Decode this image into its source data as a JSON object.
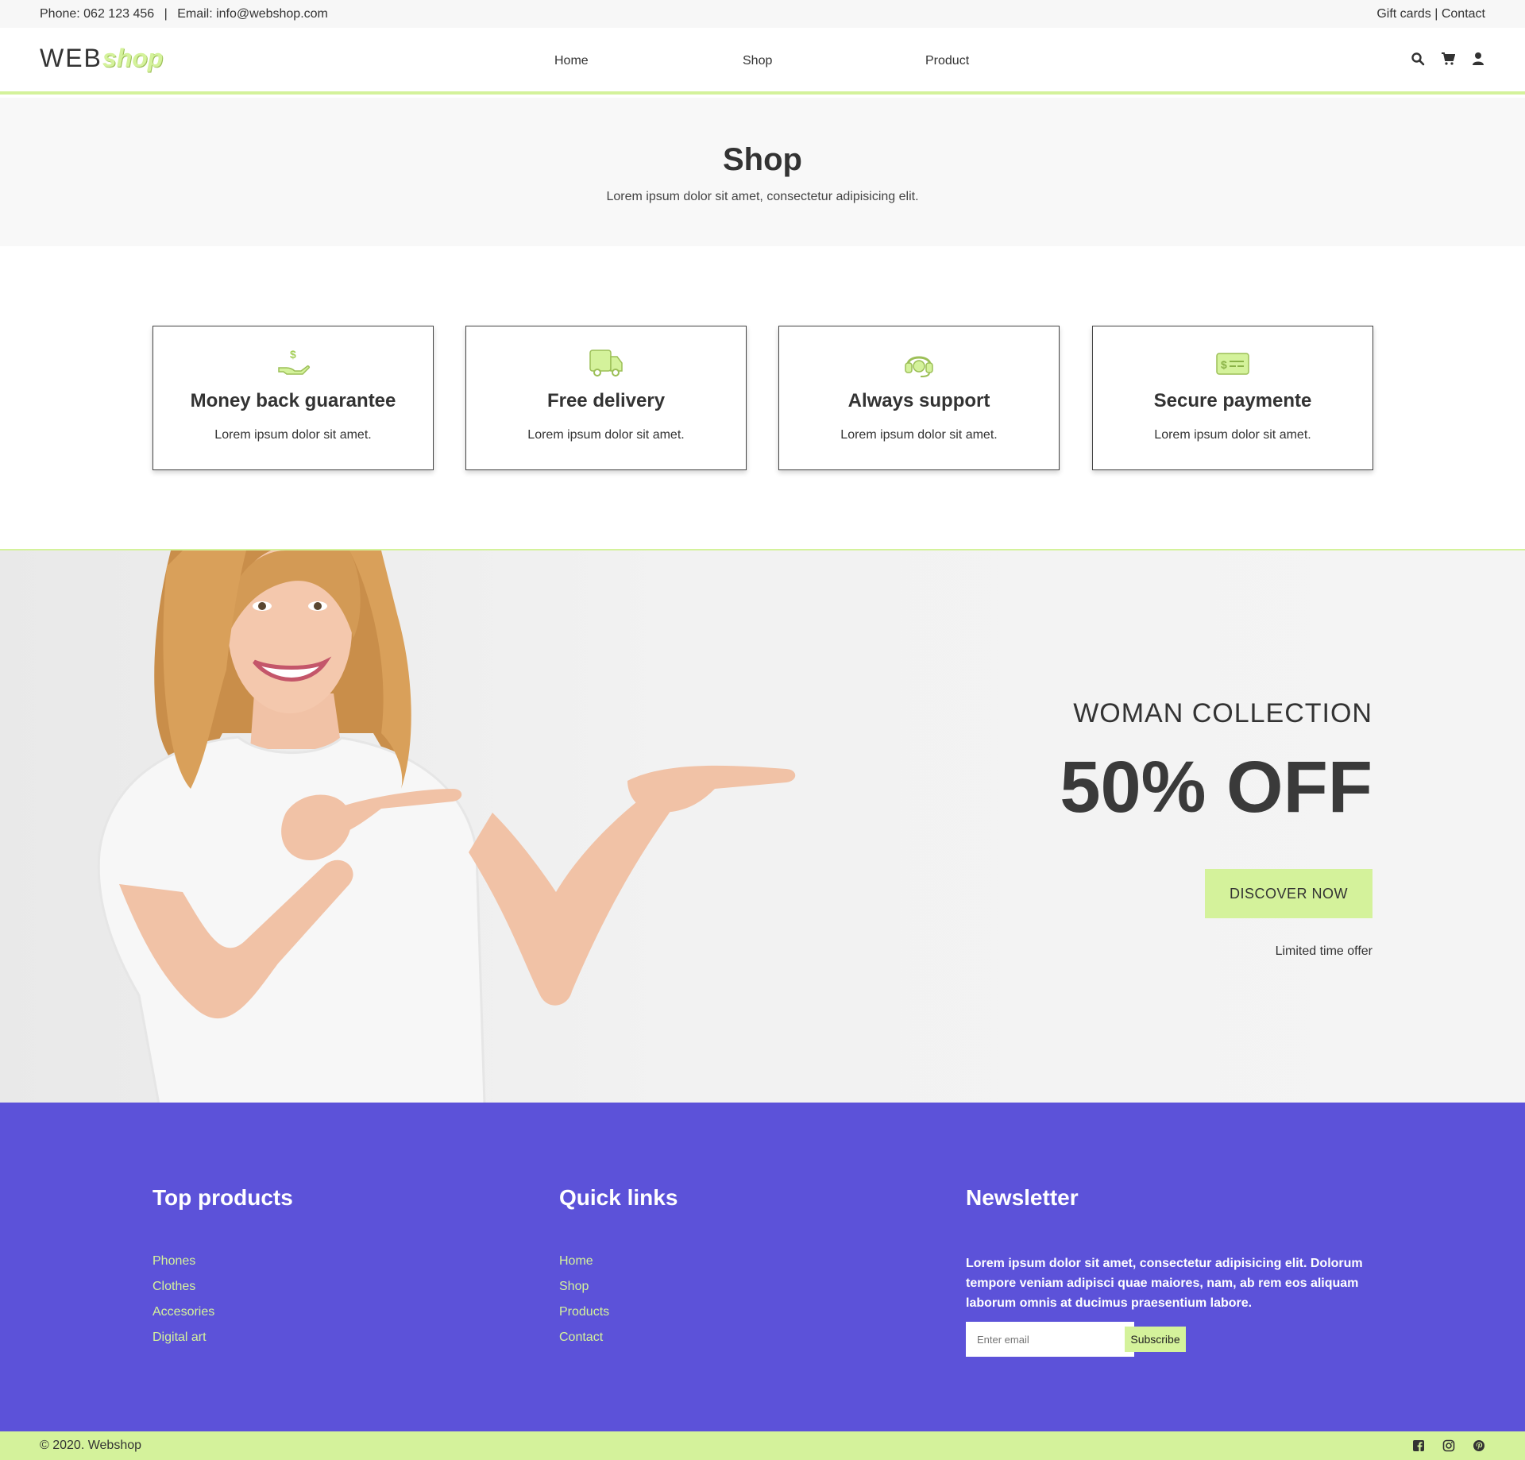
{
  "topbar": {
    "phone": "Phone: 062 123 456",
    "separator": "|",
    "email": "Email: info@webshop.com",
    "right_links": "Gift cards | Contact"
  },
  "header": {
    "logo_web": "WEB",
    "logo_shop": "shop",
    "nav": {
      "home": "Home",
      "shop": "Shop",
      "product": "Product"
    },
    "icons": [
      "search-icon",
      "cart-icon",
      "user-icon"
    ]
  },
  "page": {
    "title": "Shop",
    "subtitle": "Lorem ipsum dolor sit amet, consectetur adipisicing elit."
  },
  "features": [
    {
      "icon": "money-hand-icon",
      "title": "Money back guarantee",
      "text": "Lorem ipsum dolor sit amet."
    },
    {
      "icon": "truck-icon",
      "title": "Free delivery",
      "text": "Lorem ipsum dolor sit amet."
    },
    {
      "icon": "headset-icon",
      "title": "Always support",
      "text": "Lorem ipsum dolor sit amet."
    },
    {
      "icon": "money-check-icon",
      "title": "Secure paymente",
      "text": "Lorem ipsum dolor sit amet."
    }
  ],
  "promo": {
    "subtitle": "WOMAN COLLECTION",
    "headline": "50% OFF",
    "button": "DISCOVER NOW",
    "note": "Limited time offer"
  },
  "footer": {
    "top_products": {
      "title": "Top products",
      "links": [
        "Phones",
        "Clothes",
        "Accesories",
        "Digital art"
      ]
    },
    "quick_links": {
      "title": "Quick links",
      "links": [
        "Home",
        "Shop",
        "Products",
        "Contact"
      ]
    },
    "newsletter": {
      "title": "Newsletter",
      "text": "Lorem ipsum dolor sit amet, consectetur adipisicing elit. Dolorum tempore veniam adipisci quae maiores, nam, ab rem eos aliquam laborum omnis at ducimus praesentium labore.",
      "placeholder": "Enter email",
      "button": "Subscribe"
    }
  },
  "bottombar": {
    "copyright": "© 2020. Webshop",
    "socials": [
      "facebook-icon",
      "instagram-icon",
      "pinterest-icon"
    ]
  },
  "colors": {
    "accent": "#d4f29b",
    "footer_bg": "#5c52d9",
    "text_dark": "#333333"
  }
}
